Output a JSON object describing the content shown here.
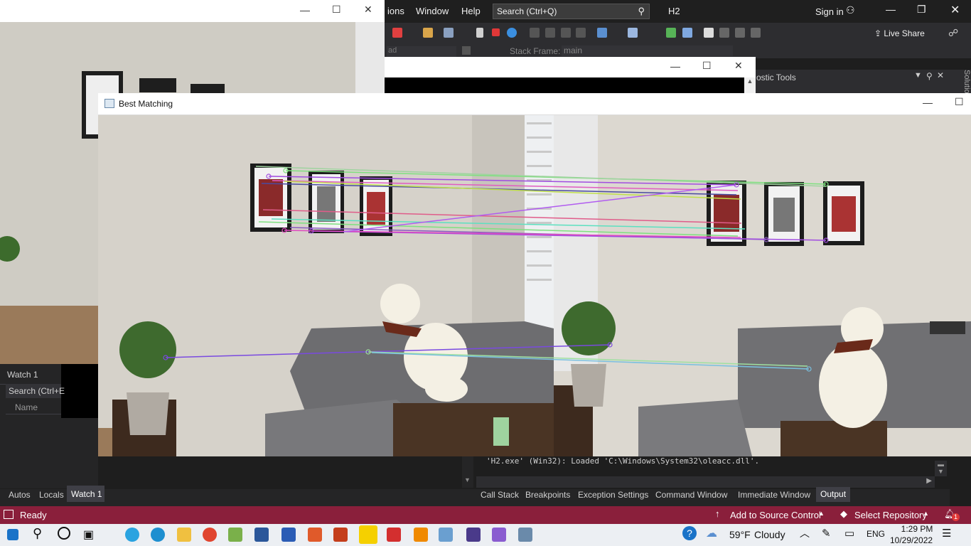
{
  "vs": {
    "menu": [
      "ions",
      "Window",
      "Help"
    ],
    "search": "Search (Ctrl+Q)",
    "solution": "H2",
    "sign_in": "Sign in",
    "live_share": "Live Share",
    "stack_frame_label": "Stack Frame:",
    "stack_frame_value": "main",
    "thread_value": "ad",
    "diag_tools": "ostic Tools",
    "side_label": "Solutio"
  },
  "watch": {
    "title": "Watch 1",
    "search": "Search (Ctrl+E",
    "name_col": "Name",
    "tabs": [
      "Autos",
      "Locals",
      "Watch 1"
    ]
  },
  "output": {
    "line": "'H2.exe' (Win32): Loaded 'C:\\Windows\\System32\\oleacc.dll'.",
    "tabs": [
      "Call Stack",
      "Breakpoints",
      "Exception Settings",
      "Command Window",
      "Immediate Window",
      "Output"
    ]
  },
  "status": {
    "ready": "Ready",
    "source_control": "Add to Source Control",
    "repository": "Select Repository",
    "notifications": "1"
  },
  "image_window": {
    "title": "Best Matching"
  },
  "taskbar": {
    "weather_temp": "59°F",
    "weather_text": "Cloudy",
    "lang": "ENG",
    "time": "1:29 PM",
    "date": "10/29/2022"
  },
  "colors": {
    "status_bar": "#8a1f3b",
    "vs_bg": "#1f1f1f",
    "accent_purple": "#9b4dca"
  }
}
